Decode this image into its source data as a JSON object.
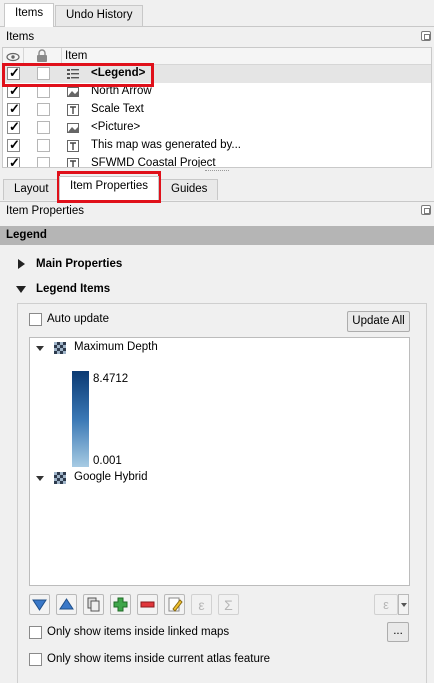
{
  "top_tabs": [
    {
      "label": "Items",
      "active": true
    },
    {
      "label": "Undo History",
      "active": false
    }
  ],
  "items_panel": {
    "title": "Items",
    "columns": {
      "item": "Item"
    },
    "rows": [
      {
        "visible": true,
        "locked": false,
        "icon": "legend-icon",
        "label": "<Legend>",
        "selected": true
      },
      {
        "visible": true,
        "locked": false,
        "icon": "picture-icon",
        "label": "North Arrow",
        "selected": false
      },
      {
        "visible": true,
        "locked": false,
        "icon": "text-icon",
        "label": "Scale Text",
        "selected": false
      },
      {
        "visible": true,
        "locked": false,
        "icon": "picture-icon",
        "label": "<Picture>",
        "selected": false
      },
      {
        "visible": true,
        "locked": false,
        "icon": "text-icon",
        "label": "This map was generated by...",
        "selected": false
      },
      {
        "visible": true,
        "locked": false,
        "icon": "text-icon",
        "label": "SFWMD Coastal Project",
        "selected": false
      }
    ]
  },
  "bottom_tabs": [
    {
      "label": "Layout",
      "active": false
    },
    {
      "label": "Item Properties",
      "active": true
    },
    {
      "label": "Guides",
      "active": false
    }
  ],
  "item_properties": {
    "title": "Item Properties",
    "panel_header": "Legend",
    "main_properties": "Main Properties",
    "legend_items": "Legend Items",
    "auto_update_label": "Auto update",
    "auto_update_checked": false,
    "update_all_label": "Update All",
    "tree": [
      {
        "label": "Maximum Depth",
        "ramp_max": "8.4712",
        "ramp_min": "0.001"
      },
      {
        "label": "Google Hybrid"
      }
    ],
    "toolbar": {
      "expression_symbol": "ε",
      "sum_symbol": "Σ",
      "expression_menu_symbol": "ε"
    },
    "linked_maps_label": "Only show items inside linked maps",
    "linked_maps_checked": false,
    "more_label": "...",
    "atlas_label": "Only show items inside current atlas feature",
    "atlas_checked": false
  },
  "colors": {
    "highlight": "#e0101a",
    "ramp_top": "#0b3a73",
    "ramp_bottom": "#a7cbe3",
    "panel_header": "#b5b5b5"
  }
}
